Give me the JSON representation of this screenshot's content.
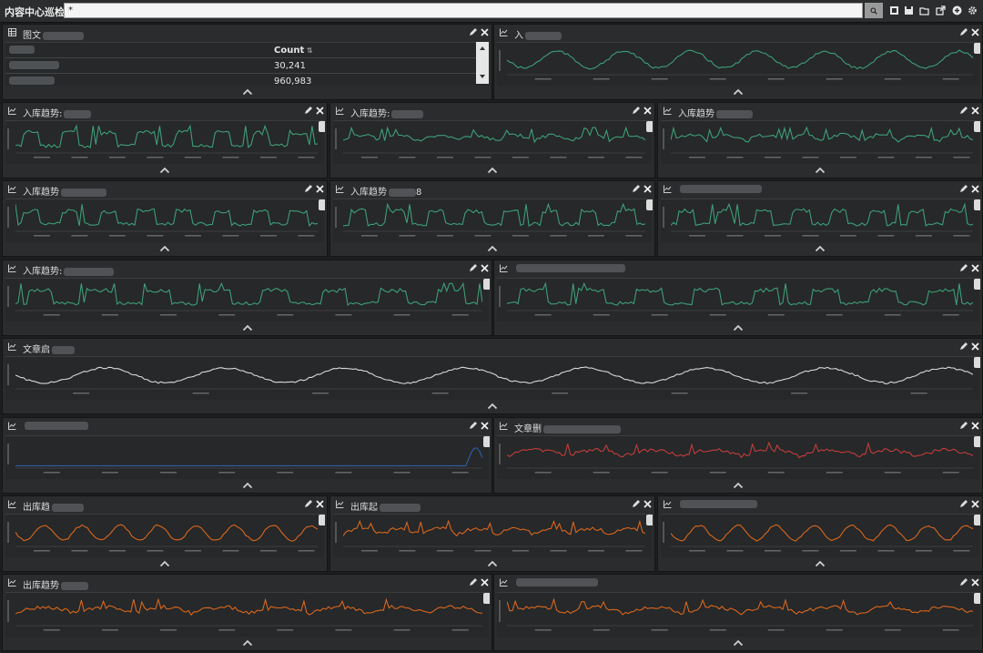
{
  "app": {
    "title": "内容中心巡检",
    "query_value": "*"
  },
  "colors": {
    "green": "#3e9e78",
    "white": "#d8d8d8",
    "red": "#c23d3d",
    "orange": "#d9661e",
    "blue": "#2f5fa8"
  },
  "panels": [
    {
      "id": "p1",
      "type": "table",
      "title": "图文"
    },
    {
      "id": "p2",
      "type": "line",
      "title": "入",
      "color": "green"
    },
    {
      "id": "p3",
      "type": "line",
      "title": "入库趋势:",
      "color": "green"
    },
    {
      "id": "p4",
      "type": "line",
      "title": "入库趋势:",
      "color": "green"
    },
    {
      "id": "p5",
      "type": "line",
      "title": "入库趋势",
      "color": "green"
    },
    {
      "id": "p6",
      "type": "line",
      "title": "入库趋势",
      "color": "green"
    },
    {
      "id": "p7",
      "type": "line",
      "title": "入库趋势",
      "suffix": "8",
      "color": "green"
    },
    {
      "id": "p8",
      "type": "line",
      "title": "",
      "color": "green"
    },
    {
      "id": "p9",
      "type": "line",
      "title": "入库趋势:",
      "color": "green"
    },
    {
      "id": "p10",
      "type": "line",
      "title": "",
      "color": "green"
    },
    {
      "id": "p11",
      "type": "line",
      "title": "文章启",
      "color": "white"
    },
    {
      "id": "p12",
      "type": "line",
      "title": "",
      "color": "blue"
    },
    {
      "id": "p13",
      "type": "line",
      "title": "文章删",
      "color": "red"
    },
    {
      "id": "p14",
      "type": "line",
      "title": "出库趋",
      "color": "orange"
    },
    {
      "id": "p15",
      "type": "line",
      "title": "出库起",
      "color": "orange"
    },
    {
      "id": "p16",
      "type": "line",
      "title": "",
      "color": "orange"
    },
    {
      "id": "p17",
      "type": "line",
      "title": "出库趋势",
      "color": "orange"
    },
    {
      "id": "p18",
      "type": "line",
      "title": "",
      "color": "orange"
    }
  ],
  "table": {
    "header": "Count",
    "rows": [
      {
        "count": "30,241"
      },
      {
        "count": "960,983"
      }
    ]
  }
}
